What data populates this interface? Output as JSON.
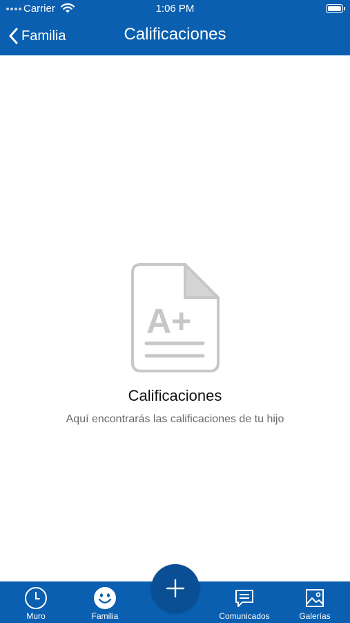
{
  "status_bar": {
    "carrier": "Carrier",
    "time": "1:06 PM"
  },
  "nav": {
    "back_label": "Familia",
    "title": "Calificaciones"
  },
  "empty_state": {
    "icon_text": "A+",
    "title": "Calificaciones",
    "subtitle": "Aquí encontrarás las calificaciones de tu hijo"
  },
  "tabbar": {
    "items": [
      {
        "label": "Muro",
        "icon": "clock-icon"
      },
      {
        "label": "Familia",
        "icon": "smiley-icon",
        "active": true
      },
      {
        "label": "Comunicados",
        "icon": "chat-bubble-icon"
      },
      {
        "label": "Galerías",
        "icon": "image-icon"
      }
    ],
    "fab_icon": "plus-icon"
  },
  "colors": {
    "primary": "#0a5fb0",
    "fab": "#0a4f94",
    "icon_gray": "#c7c7c7"
  }
}
